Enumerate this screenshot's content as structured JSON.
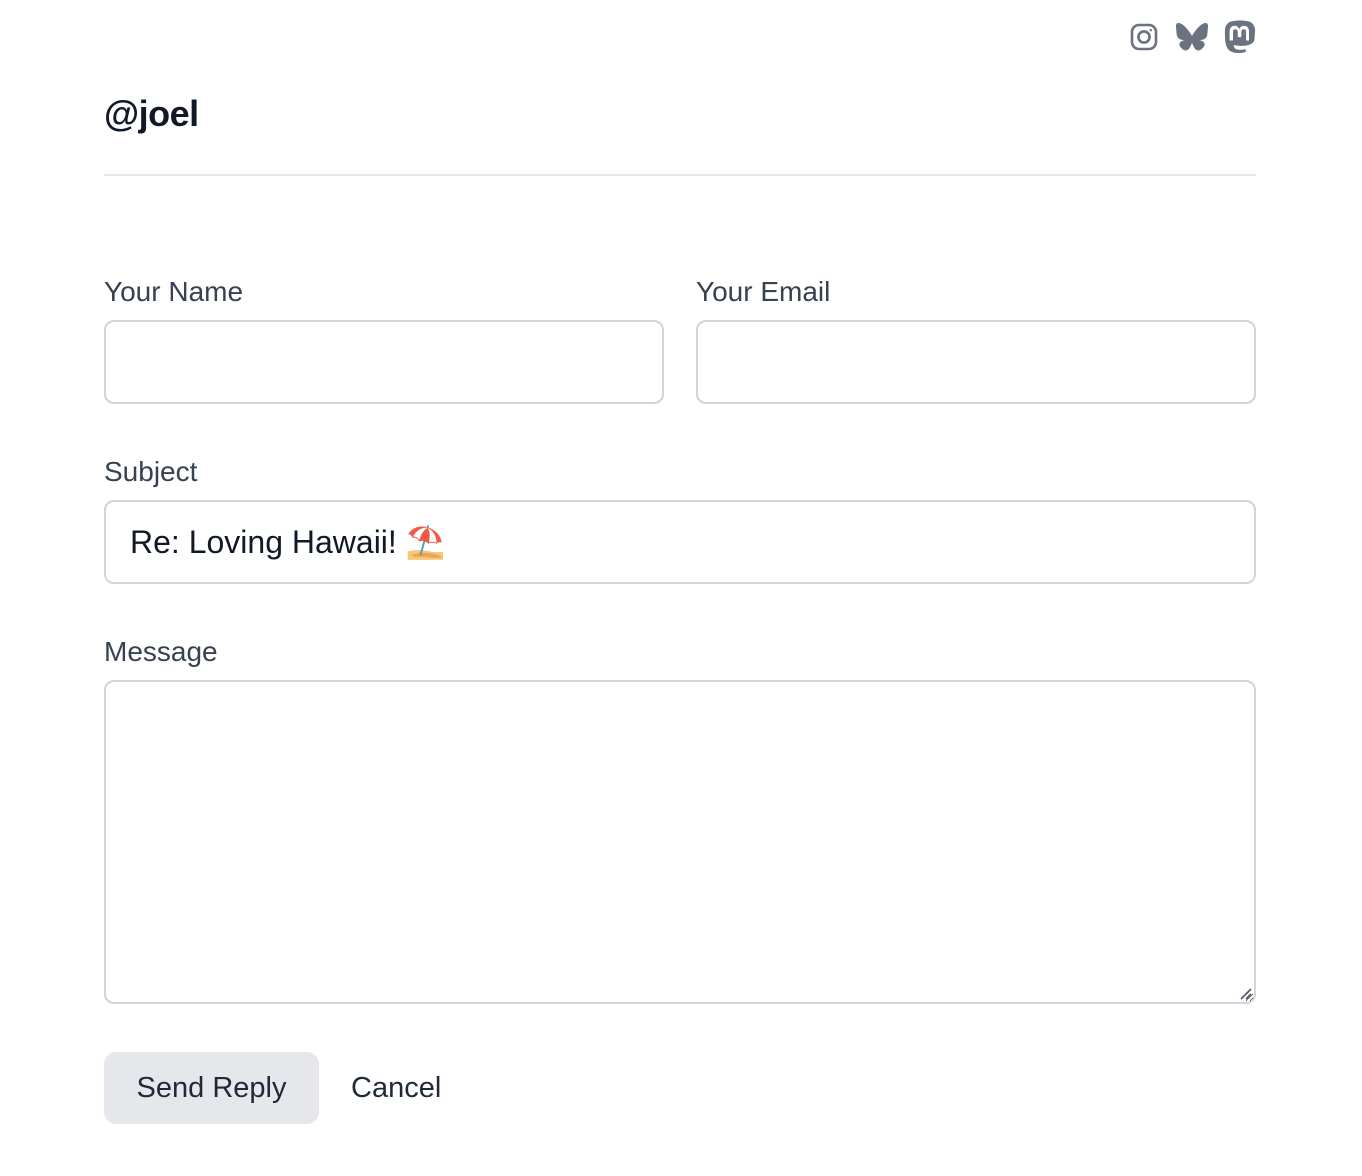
{
  "social": {
    "icons": [
      "instagram-icon",
      "bluesky-icon",
      "mastodon-icon"
    ],
    "icon_color": "#6b7280"
  },
  "profile": {
    "handle": "@joel"
  },
  "form": {
    "name_label": "Your Name",
    "name_value": "",
    "email_label": "Your Email",
    "email_value": "",
    "subject_label": "Subject",
    "subject_value": "Re: Loving Hawaii! ⛱️",
    "message_label": "Message",
    "message_value": "",
    "send_label": "Send Reply",
    "cancel_label": "Cancel"
  },
  "colors": {
    "text": "#111827",
    "label": "#374151",
    "border": "#d1d5db",
    "button_bg": "#e5e7eb"
  }
}
